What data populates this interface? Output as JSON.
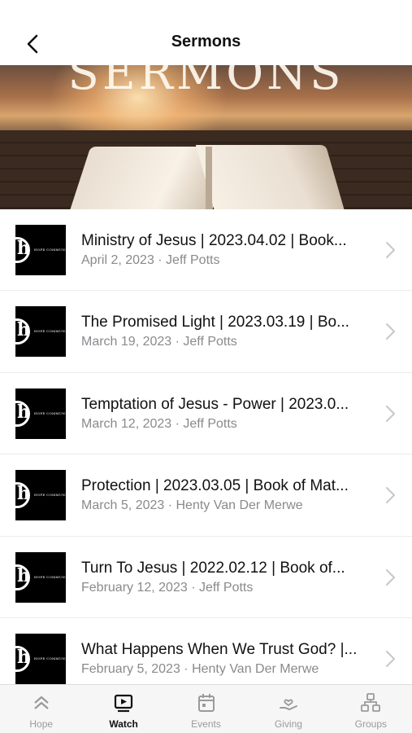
{
  "header": {
    "title": "Sermons",
    "back_icon": "chevron-left-icon"
  },
  "hero": {
    "title": "SERMONS"
  },
  "thumbnail": {
    "logo_letter": "h",
    "logo_text": "HOPE COMMUNITY"
  },
  "sermons": [
    {
      "title": "Ministry of Jesus | 2023.04.02 | Book...",
      "subtitle": "April 2, 2023 · Jeff Potts"
    },
    {
      "title": "The Promised Light | 2023.03.19 | Bo...",
      "subtitle": "March 19, 2023 · Jeff Potts"
    },
    {
      "title": "Temptation of Jesus - Power | 2023.0...",
      "subtitle": "March 12, 2023 · Jeff Potts"
    },
    {
      "title": "Protection | 2023.03.05 | Book of Mat...",
      "subtitle": "March 5, 2023 · Henty Van Der Merwe"
    },
    {
      "title": "Turn To Jesus | 2022.02.12 | Book of...",
      "subtitle": "February 12, 2023 · Jeff Potts"
    },
    {
      "title": "What Happens When We Trust God? |...",
      "subtitle": "February 5, 2023 · Henty Van Der Merwe"
    }
  ],
  "tabs": [
    {
      "label": "Hope",
      "icon": "double-chevron-up-icon",
      "active": false
    },
    {
      "label": "Watch",
      "icon": "play-screen-icon",
      "active": true
    },
    {
      "label": "Events",
      "icon": "calendar-icon",
      "active": false
    },
    {
      "label": "Giving",
      "icon": "hand-heart-icon",
      "active": false
    },
    {
      "label": "Groups",
      "icon": "people-network-icon",
      "active": false
    }
  ],
  "colors": {
    "active_tab": "#111111",
    "inactive_tab": "#9a9a9a",
    "subtitle": "#8a8a8e",
    "tabbar_bg": "#f6f6f6"
  }
}
